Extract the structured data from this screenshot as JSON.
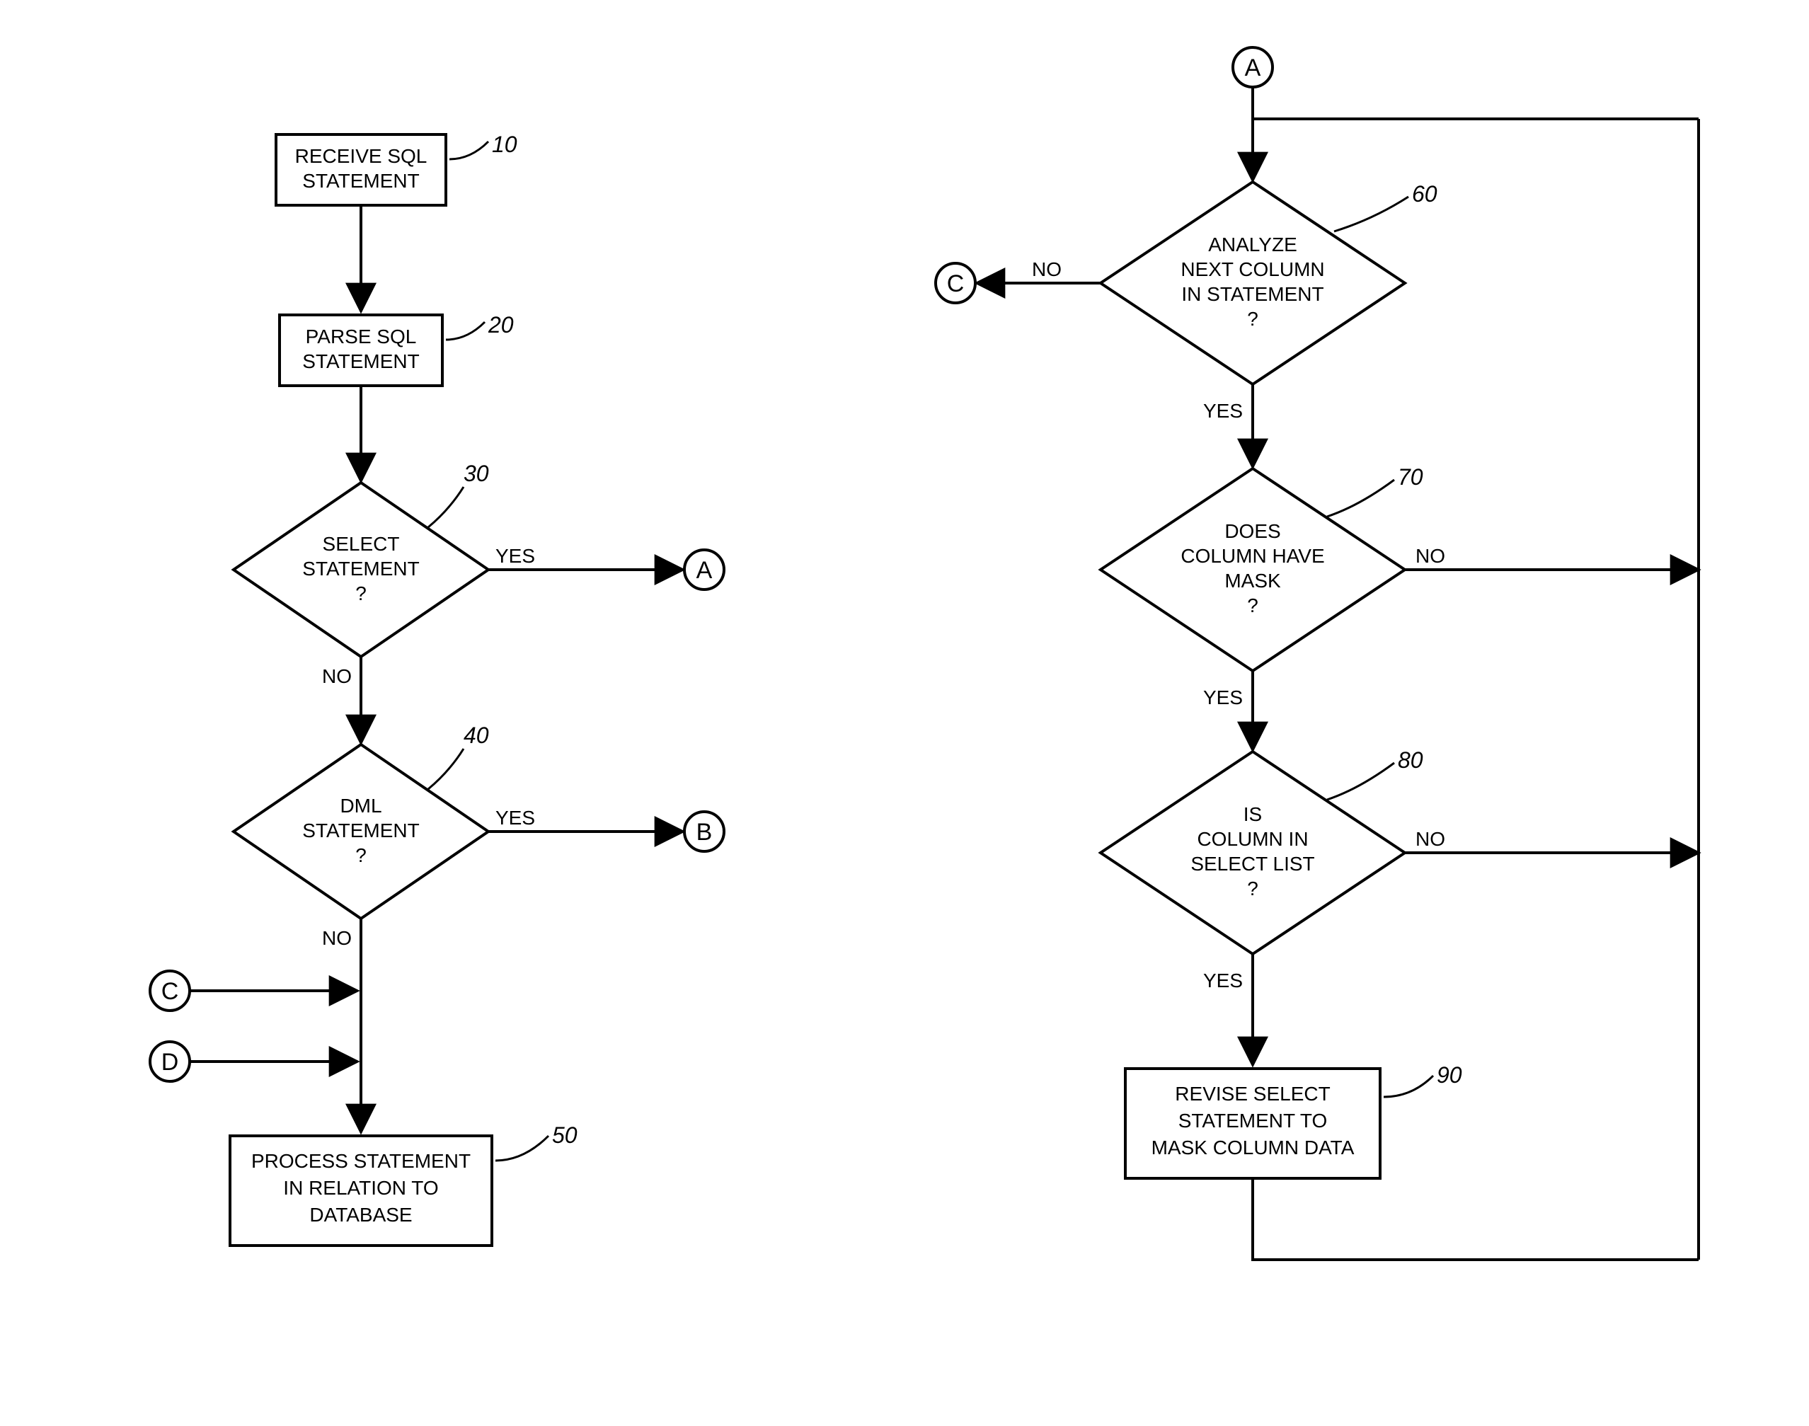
{
  "chart_data": {
    "type": "flowchart",
    "refs": [
      "10",
      "20",
      "30",
      "40",
      "50",
      "60",
      "70",
      "80",
      "90"
    ],
    "connectors": [
      "A",
      "B",
      "C",
      "D"
    ],
    "nodes": {
      "n10": {
        "ref": "10",
        "shape": "rect",
        "lines": [
          "RECEIVE SQL",
          "STATEMENT"
        ]
      },
      "n20": {
        "ref": "20",
        "shape": "rect",
        "lines": [
          "PARSE SQL",
          "STATEMENT"
        ]
      },
      "n30": {
        "ref": "30",
        "shape": "diamond",
        "lines": [
          "SELECT",
          "STATEMENT",
          "?"
        ]
      },
      "n40": {
        "ref": "40",
        "shape": "diamond",
        "lines": [
          "DML",
          "STATEMENT",
          "?"
        ]
      },
      "n50": {
        "ref": "50",
        "shape": "rect",
        "lines": [
          "PROCESS STATEMENT",
          "IN RELATION TO",
          "DATABASE"
        ]
      },
      "n60": {
        "ref": "60",
        "shape": "diamond",
        "lines": [
          "ANALYZE",
          "NEXT COLUMN",
          "IN STATEMENT",
          "?"
        ]
      },
      "n70": {
        "ref": "70",
        "shape": "diamond",
        "lines": [
          "DOES",
          "COLUMN HAVE",
          "MASK",
          "?"
        ]
      },
      "n80": {
        "ref": "80",
        "shape": "diamond",
        "lines": [
          "IS",
          "COLUMN IN",
          "SELECT LIST",
          "?"
        ]
      },
      "n90": {
        "ref": "90",
        "shape": "rect",
        "lines": [
          "REVISE SELECT",
          "STATEMENT TO",
          "MASK COLUMN DATA"
        ]
      }
    },
    "edges": [
      {
        "from": "n10",
        "to": "n20"
      },
      {
        "from": "n20",
        "to": "n30"
      },
      {
        "from": "n30",
        "to": "A",
        "label": "YES"
      },
      {
        "from": "n30",
        "to": "n40",
        "label": "NO"
      },
      {
        "from": "n40",
        "to": "B",
        "label": "YES"
      },
      {
        "from": "n40",
        "to": "n50",
        "label": "NO",
        "merge": [
          "C",
          "D"
        ]
      },
      {
        "from": "A",
        "to": "n60"
      },
      {
        "from": "n60",
        "to": "C",
        "label": "NO"
      },
      {
        "from": "n60",
        "to": "n70",
        "label": "YES"
      },
      {
        "from": "n70",
        "to": "n60",
        "label": "NO",
        "loop": true
      },
      {
        "from": "n70",
        "to": "n80",
        "label": "YES"
      },
      {
        "from": "n80",
        "to": "n60",
        "label": "NO",
        "loop": true
      },
      {
        "from": "n80",
        "to": "n90",
        "label": "YES"
      },
      {
        "from": "n90",
        "to": "n60",
        "loop": true
      }
    ]
  },
  "labels": {
    "yes": "YES",
    "no": "NO"
  },
  "connectors": {
    "A": "A",
    "B": "B",
    "C": "C",
    "D": "D"
  }
}
